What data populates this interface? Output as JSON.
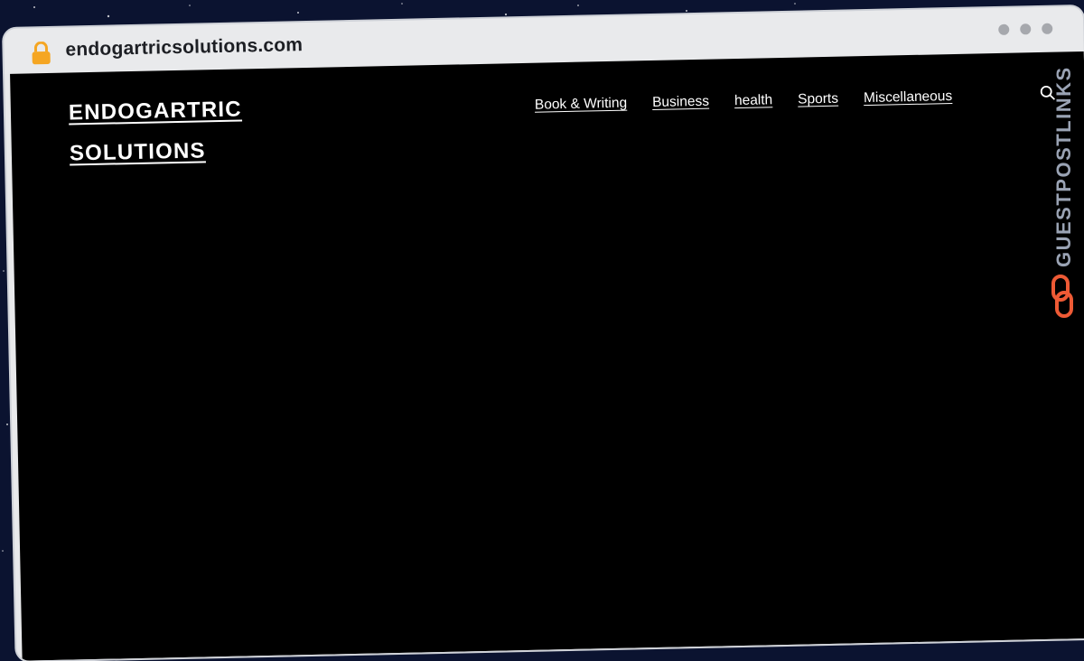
{
  "browser": {
    "url": "endogartricsolutions.com"
  },
  "site": {
    "logo_line1": "ENDOGARTRIC",
    "logo_line2": "SOLUTIONS",
    "nav": [
      {
        "label": "Book & Writing"
      },
      {
        "label": "Business"
      },
      {
        "label": "health"
      },
      {
        "label": "Sports"
      },
      {
        "label": "Miscellaneous"
      }
    ]
  },
  "watermark": {
    "text": "GUESTPOSTLINKS"
  },
  "colors": {
    "page_background": "#0b1330",
    "viewport_background": "#000000",
    "lock": "#f5a623",
    "watermark_accent": "#ee5a35",
    "watermark_text": "#9aa3b4"
  },
  "icons": [
    "lock-icon",
    "search-icon",
    "link-chain-icon"
  ]
}
